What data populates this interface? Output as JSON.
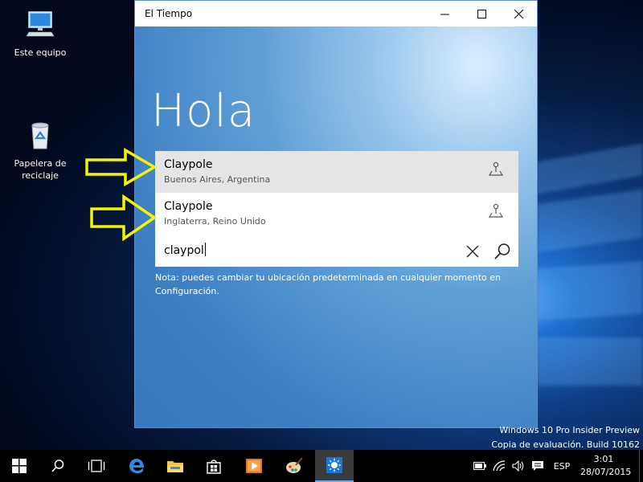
{
  "desktop": {
    "icons": [
      {
        "label": "Este equipo",
        "icon": "computer-icon"
      },
      {
        "label": "Papelera de reciclaje",
        "icon": "recycle-bin-icon"
      }
    ],
    "watermark": {
      "line1": "Windows 10 Pro Insider Preview",
      "line2": "Copia de evaluación. Build 10162"
    }
  },
  "window": {
    "title": "El Tiempo",
    "greeting": "Hola",
    "suggestions": [
      {
        "name": "Claypole",
        "region": "Buenos Aires, Argentina",
        "icon": "map-pin-icon",
        "highlighted": true
      },
      {
        "name": "Claypole",
        "region": "Inglaterra, Reino Unido",
        "icon": "map-pin-icon",
        "highlighted": false
      }
    ],
    "search": {
      "value": "claypol"
    },
    "note": "Nota: puedes cambiar tu ubicación predeterminada en cualquier momento en Configuración.",
    "colors": {
      "titlebar": "#ffffff",
      "accent": "#4a8fd4"
    }
  },
  "taskbar": {
    "items": [
      "windows-start-icon",
      "search-icon",
      "task-view-icon",
      "edge-icon",
      "file-explorer-icon",
      "store-icon",
      "media-player-icon",
      "paint-icon",
      "weather-icon"
    ],
    "tray": {
      "language": "ESP",
      "time": "3:01",
      "date": "28/07/2015"
    }
  },
  "annotations": {
    "arrow_color": "#f5f500"
  }
}
